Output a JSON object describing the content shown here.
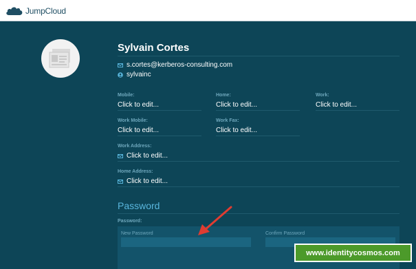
{
  "brand": {
    "name": "JumpCloud"
  },
  "user": {
    "name": "Sylvain Cortes",
    "email": "s.cortes@kerberos-consulting.com",
    "username": "sylvainc"
  },
  "fields": {
    "mobile": {
      "label": "Mobile:",
      "value": "Click to edit..."
    },
    "home": {
      "label": "Home:",
      "value": "Click to edit..."
    },
    "work": {
      "label": "Work:",
      "value": "Click to edit..."
    },
    "work_mobile": {
      "label": "Work Mobile:",
      "value": "Click to edit..."
    },
    "work_fax": {
      "label": "Work Fax:",
      "value": "Click to edit..."
    },
    "work_address": {
      "label": "Work Address:",
      "value": "Click to edit..."
    },
    "home_address": {
      "label": "Home Address:",
      "value": "Click to edit..."
    }
  },
  "password": {
    "section_title": "Password",
    "label": "Password:",
    "new_label": "New Password",
    "confirm_label": "Confirm Password"
  },
  "watermark": {
    "text": "www.identitycosmos.com"
  },
  "colors": {
    "background": "#0d4557",
    "accent": "#59b6dd",
    "label": "#6fa8bd",
    "arrow": "#e03c31",
    "watermark": "#4c9a2a"
  }
}
